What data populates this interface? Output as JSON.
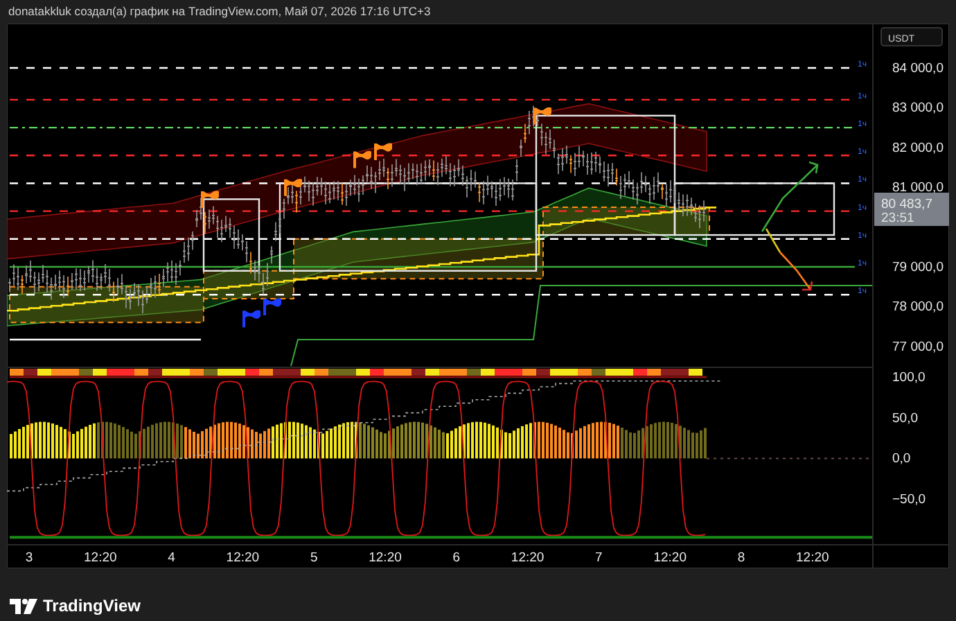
{
  "header": {
    "text": "donatakkluk создал(а) график на TradingView.com, Май 07, 2026 17:16 UTC+3"
  },
  "price_axis": {
    "currency": "USDT",
    "ticks": [
      "84 000,0",
      "83 000,0",
      "82 000,0",
      "81 000,0",
      "79 000,0",
      "78 000,0",
      "77 000,0"
    ]
  },
  "price_badge": {
    "price": "80 483,7",
    "countdown": "23:51"
  },
  "line_labels": [
    "1ч",
    "1ч",
    "1ч",
    "1ч",
    "1ч",
    "1ч",
    "1ч",
    "1ч",
    "1ч"
  ],
  "oscillator_axis": {
    "ticks": [
      "100,0",
      "50,0",
      "0,0",
      "−50,0"
    ]
  },
  "time_axis": {
    "labels": [
      "3",
      "12:20",
      "4",
      "12:20",
      "5",
      "12:20",
      "6",
      "12:20",
      "7",
      "12:20",
      "8",
      "12:20"
    ]
  },
  "logo": {
    "text": "TradingView"
  }
}
